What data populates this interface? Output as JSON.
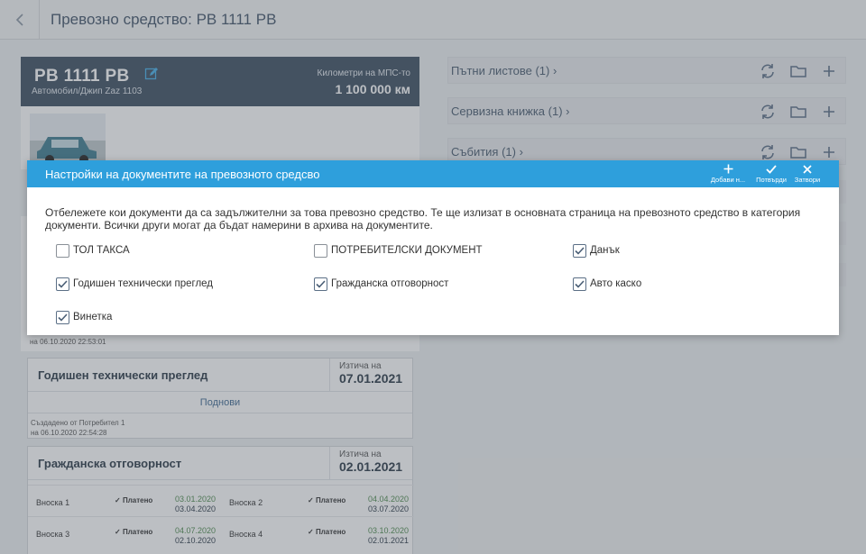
{
  "page": {
    "title": "Превозно средство: РВ 1111 РВ"
  },
  "vehicle": {
    "plate": "РВ 1111 РВ",
    "model": "Автомобил/Джип Zaz 1103",
    "km_label": "Километри на МПС-то",
    "km_value": "1 100 000 км"
  },
  "panels": [
    {
      "label": "Пътни листове (1)"
    },
    {
      "label": "Сервизна книжка (1)"
    },
    {
      "label": "Събития (1)"
    }
  ],
  "documents": {
    "old_created": "на 06.10.2020 22:53:01",
    "inspection": {
      "title": "Годишен технически преглед",
      "expires_label": "Изтича на",
      "expires": "07.01.2021",
      "renew": "Поднови",
      "created_by": "Създадено от Потребител 1",
      "created_on": "на 06.10.2020 22:54:28"
    },
    "liability": {
      "title": "Гражданска отговорност",
      "expires_label": "Изтича на",
      "expires": "02.01.2021",
      "installments": [
        {
          "name": "Вноска 1",
          "status": "Платено",
          "date1": "03.01.2020",
          "date2": "03.04.2020"
        },
        {
          "name": "Вноска 2",
          "status": "Платено",
          "date1": "04.04.2020",
          "date2": "03.07.2020"
        },
        {
          "name": "Вноска 3",
          "status": "Платено",
          "date1": "04.07.2020",
          "date2": "02.10.2020"
        },
        {
          "name": "Вноска 4",
          "status": "Платено",
          "date1": "03.10.2020",
          "date2": "02.01.2021"
        }
      ]
    }
  },
  "modal": {
    "title": "Настройки на документите на превозното средсво",
    "buttons": {
      "add": "Добави н...",
      "confirm": "Потвърди",
      "close": "Затвори"
    },
    "description": "Отбележете кои документи да са задължителни за това превозно средство. Те ще излизат в основната страница на превозното средство в категория документи. Всички други могат да бъдат намерини в архива на документите.",
    "options": [
      {
        "label": "ТОЛ ТАКСА",
        "checked": false
      },
      {
        "label": "ПОТРЕБИТЕЛСКИ ДОКУМЕНТ",
        "checked": false
      },
      {
        "label": "Данък",
        "checked": true
      },
      {
        "label": "Годишен технически преглед",
        "checked": true
      },
      {
        "label": "Гражданска отговорност",
        "checked": true
      },
      {
        "label": "Авто каско",
        "checked": true
      },
      {
        "label": "Винетка",
        "checked": true
      }
    ]
  },
  "colors": {
    "accent": "#2e9fdc",
    "vehicle_header": "#3e4f62",
    "paid_date": "#4e8a4e"
  }
}
